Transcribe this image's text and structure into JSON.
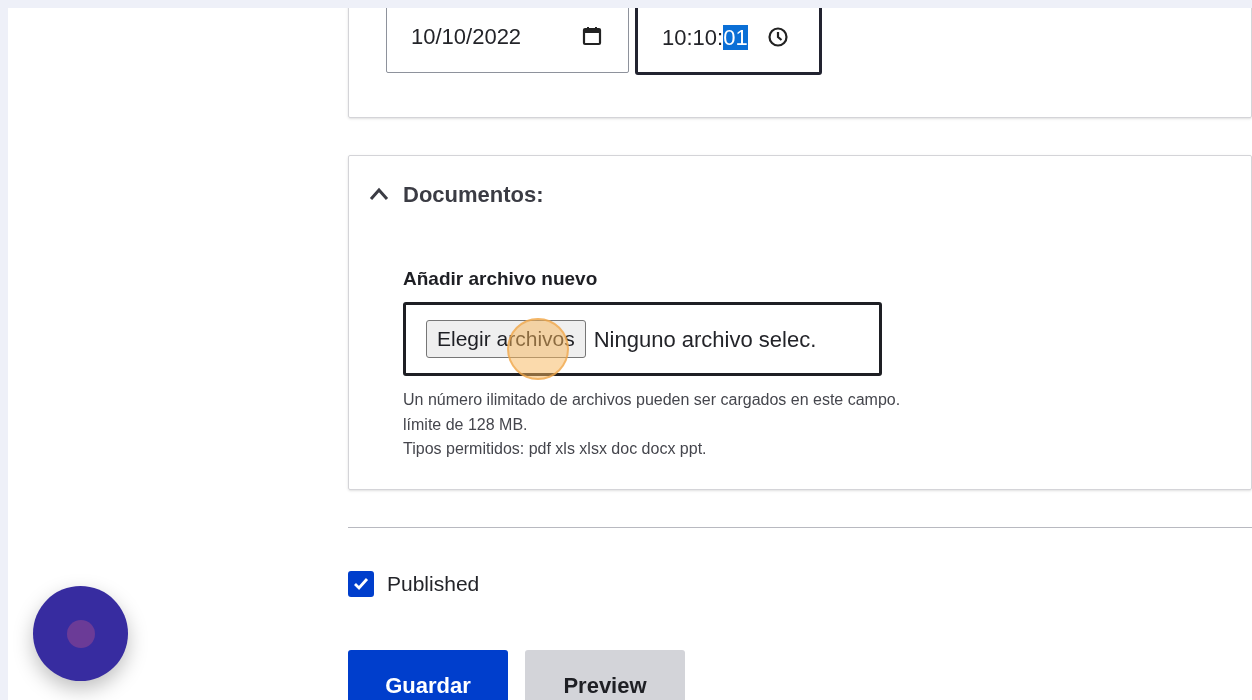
{
  "date_field": {
    "value": "10/10/2022"
  },
  "time_field": {
    "value": "10:10:",
    "selected_segment": "01",
    "focused": true
  },
  "documents_section": {
    "title": "Documentos:",
    "expanded": true,
    "upload": {
      "label": "Añadir archivo nuevo",
      "button": "Elegir archivos",
      "status": "Ninguno archivo selec."
    },
    "help_lines": [
      "Un número ilimitado de archivos pueden ser cargados en este campo.",
      "límite de 128 MB.",
      "Tipos permitidos: pdf xls xlsx doc docx ppt."
    ]
  },
  "published": {
    "label": "Published",
    "checked": true
  },
  "buttons": [
    {
      "label": "Guardar",
      "kind": "primary"
    },
    {
      "label": "Preview",
      "kind": "secondary"
    }
  ]
}
